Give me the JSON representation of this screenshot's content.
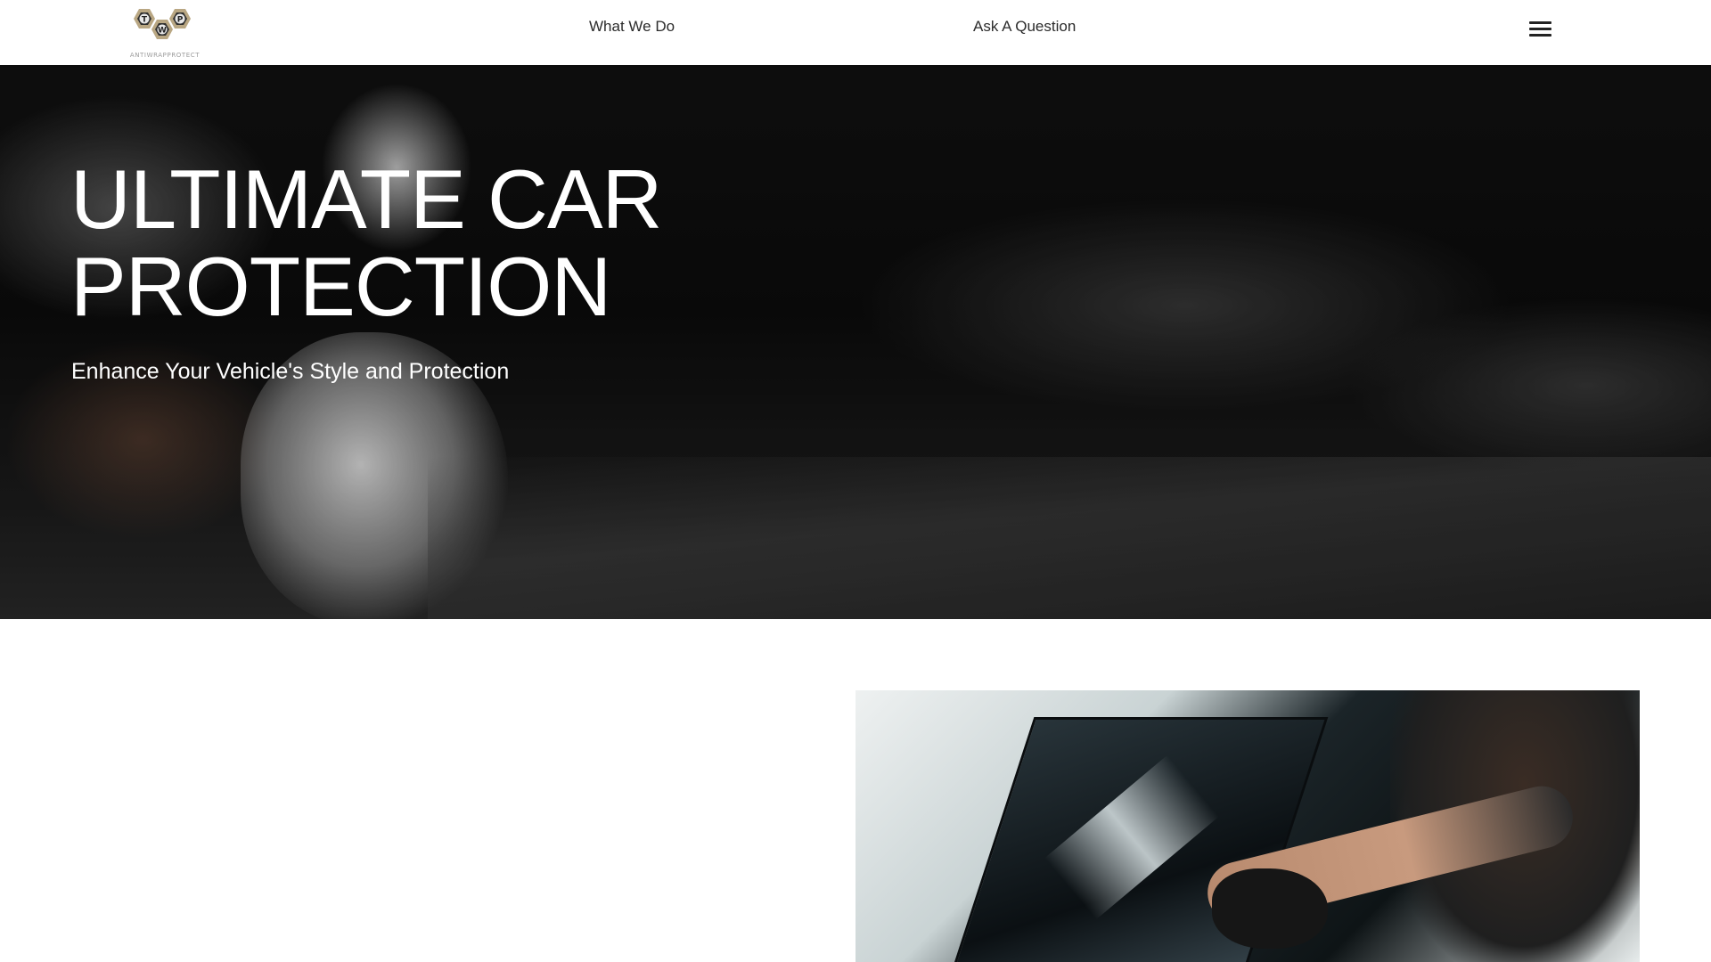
{
  "header": {
    "logo": {
      "letters": [
        "T",
        "W",
        "P"
      ],
      "text": "ANTIWRAPPROTECT"
    },
    "nav": {
      "what_we_do": "What We Do",
      "ask_question": "Ask A Question"
    },
    "menu_icon": "hamburger-menu-icon"
  },
  "hero": {
    "title": "ULTIMATE CAR\nPROTECTION",
    "subtitle": "Enhance Your Vehicle's Style and Protection"
  },
  "colors": {
    "header_bg": "#ffffff",
    "hero_text": "#ffffff",
    "nav_text": "#2b2b2b",
    "logo_gold": "#b9a783",
    "logo_dark": "#2f2f2f"
  }
}
